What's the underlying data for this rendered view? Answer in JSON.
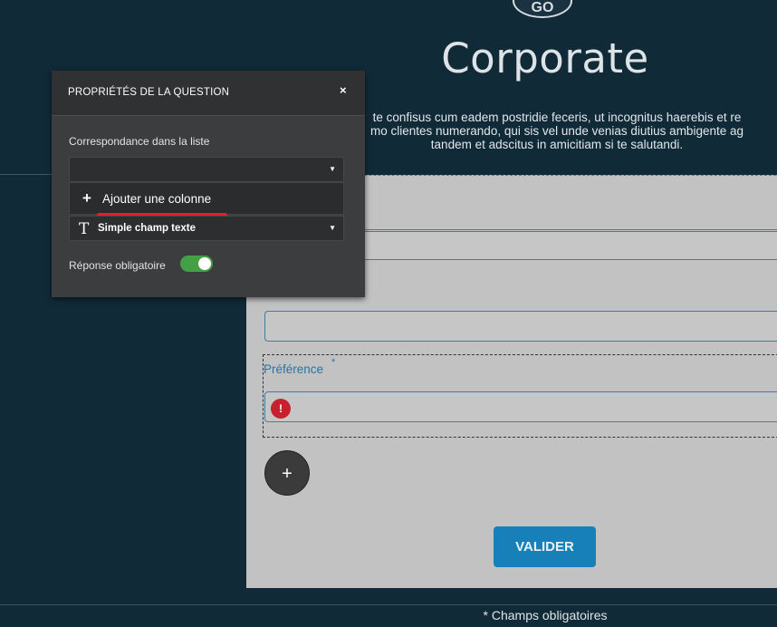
{
  "header": {
    "logo_text": "GO",
    "brand": "Corporate",
    "intro_lines": [
      "te confisus cum eadem postridie feceris, ut incognitus haerebis et re",
      "mo clientes numerando, qui sis vel unde venias diutius ambigente ag",
      "tandem et adscitus in amicitiam si te salutandi."
    ]
  },
  "form": {
    "question_label": "Préférence",
    "required_mark": "*",
    "error_icon": "warning-icon",
    "add_icon": "+",
    "submit_label": "VALIDER",
    "footer_note": "* Champs obligatoires"
  },
  "panel": {
    "title": "PROPRIÉTÉS DE LA QUESTION",
    "close_label": "×",
    "mapping_label": "Correspondance dans la liste",
    "mapping_value": "",
    "dropdown_option": "Ajouter une colonne",
    "type_label": "Simple champ texte",
    "required_label": "Réponse obligatoire",
    "required_on": true
  },
  "colors": {
    "background": "#112a38",
    "accent": "#1780b8",
    "toggle_on": "#43a047",
    "error": "#c8202f",
    "highlight_mark": "#e0202a"
  }
}
